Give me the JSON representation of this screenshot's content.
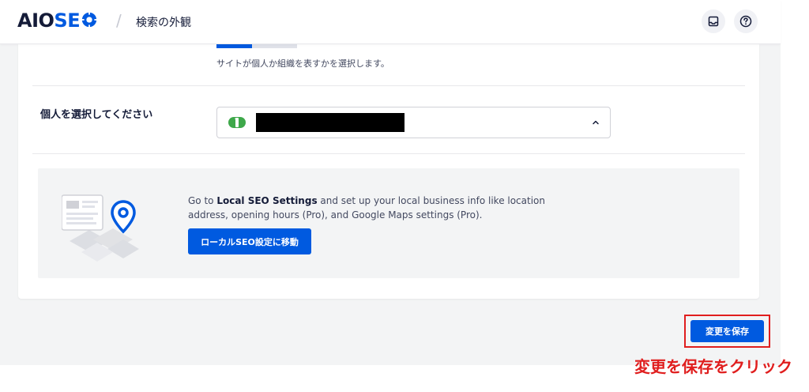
{
  "header": {
    "logo_aio": "AIO",
    "logo_seo": "SE",
    "breadcrumb_separator": "/",
    "breadcrumb": "検索の外観",
    "inbox_icon": "inbox-icon",
    "help_icon": "question-circle-icon"
  },
  "settings": {
    "type_helptext": "サイトが個人か組織を表すかを選択します。",
    "person_label": "個人を選択してください",
    "person_select": {
      "avatar_icon": "user-avatar-icon",
      "value": "",
      "chevron_icon": "chevron-up-icon"
    }
  },
  "promo": {
    "text_prefix": "Go to ",
    "text_link": "Local SEO Settings",
    "text_suffix": " and set up your local business info like location address, opening hours (Pro), and Google Maps settings (Pro).",
    "button_label": "ローカルSEO設定に移動",
    "illustration_icon": "map-pin-illustration-icon"
  },
  "save": {
    "button_label": "変更を保存"
  },
  "annotation": {
    "text": "変更を保存をクリック"
  },
  "colors": {
    "primary": "#005ae0",
    "annotation_red": "#e01e1e",
    "dark_text": "#141b38"
  }
}
